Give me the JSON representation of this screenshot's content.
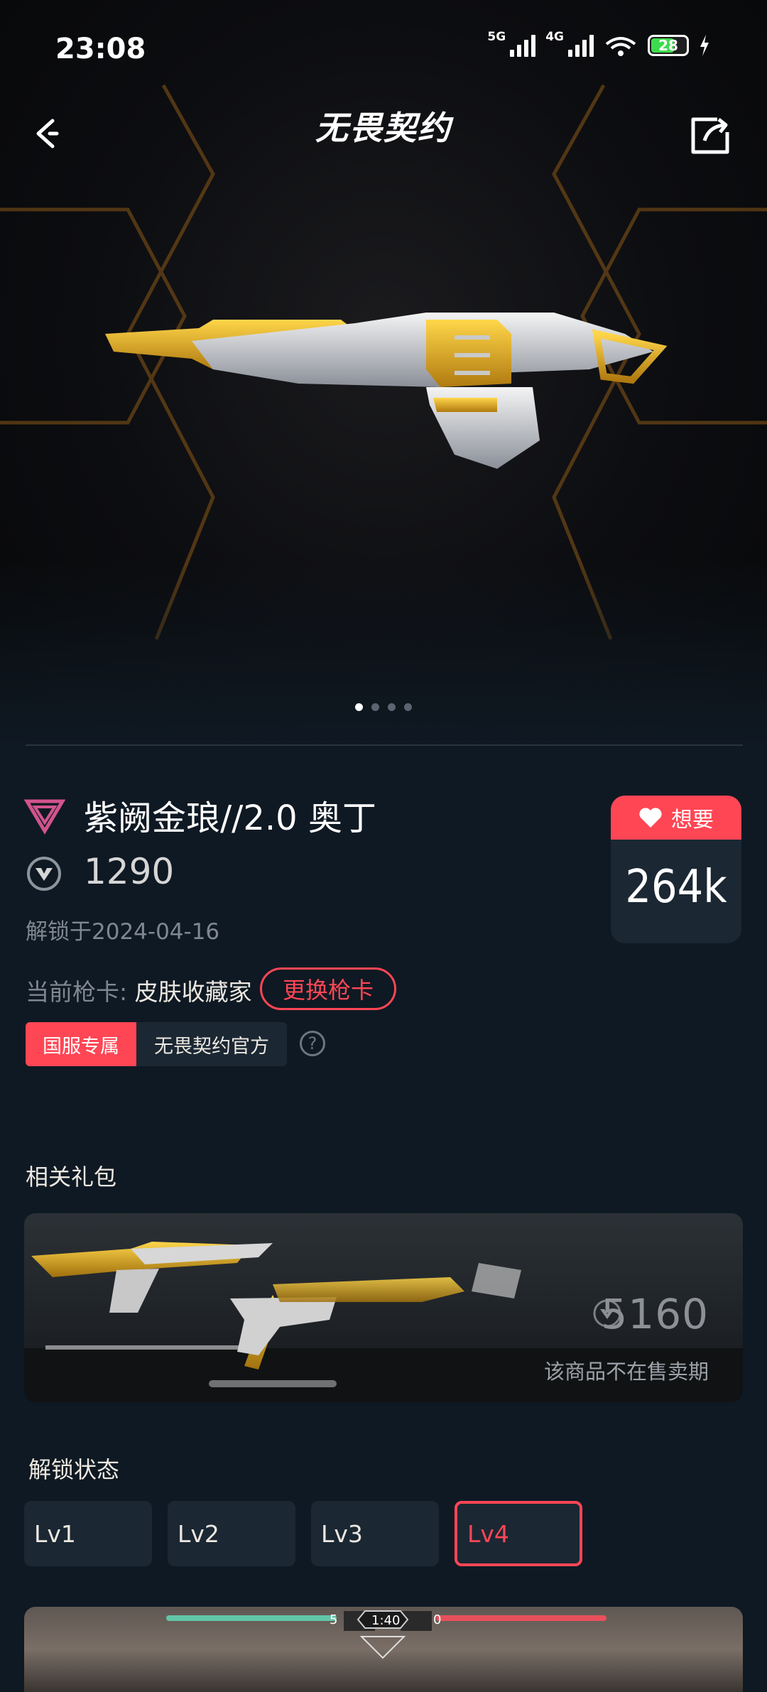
{
  "status_bar": {
    "time": "23:08",
    "net1": "5G",
    "net2": "4G",
    "battery": "28"
  },
  "header": {
    "title": "无畏契约"
  },
  "carousel": {
    "pages": 4,
    "active_index": 0
  },
  "skin": {
    "name": "紫阙金琅//2.0 奥丁",
    "price": "1290",
    "unlock_date": "解锁于2024-04-16",
    "current_card_label": "当前枪卡: ",
    "current_card_value": "皮肤收藏家",
    "change_card_label": "更换枪卡",
    "tags": [
      "国服专属",
      "无畏契约官方"
    ]
  },
  "want": {
    "label": "想要",
    "count": "264k"
  },
  "related": {
    "title": "相关礼包",
    "bundle_price": "5160",
    "bundle_status": "该商品不在售卖期"
  },
  "unlock": {
    "title": "解锁状态",
    "levels": [
      "Lv1",
      "Lv2",
      "Lv3",
      "Lv4"
    ],
    "active_level": "Lv4"
  },
  "preview_hud": {
    "left_score": "5",
    "timer": "1:40",
    "right_score": "0"
  },
  "colors": {
    "accent": "#ff4655",
    "background": "#0f1923",
    "card": "#1b2733",
    "gold": "#e7b21e"
  }
}
